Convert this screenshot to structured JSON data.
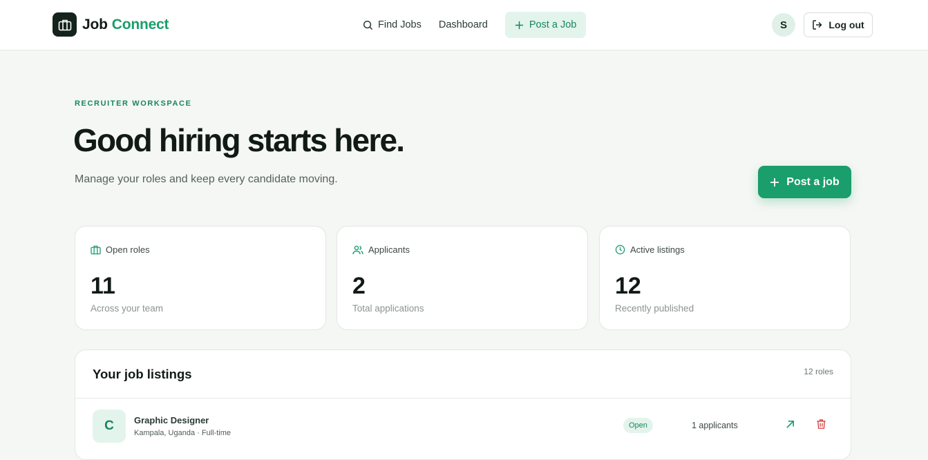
{
  "header": {
    "brand_part1": "Job",
    "brand_part2": "Connect",
    "nav_find_jobs": "Find Jobs",
    "nav_dashboard": "Dashboard",
    "nav_post_job": "Post a Job",
    "avatar_initial": "S",
    "logout_label": "Log out"
  },
  "hero": {
    "eyebrow": "RECRUITER WORKSPACE",
    "title": "Good hiring starts here.",
    "subtitle": "Manage your roles and keep every candidate moving.",
    "cta_label": "Post a job"
  },
  "stats": [
    {
      "icon": "briefcase-icon",
      "label": "Open roles",
      "value": "11",
      "caption": "Across your team"
    },
    {
      "icon": "users-icon",
      "label": "Applicants",
      "value": "2",
      "caption": "Total applications"
    },
    {
      "icon": "clock-icon",
      "label": "Active listings",
      "value": "12",
      "caption": "Recently published"
    }
  ],
  "listings": {
    "title": "Your job listings",
    "count": "12 roles",
    "rows": [
      {
        "initial": "C",
        "title": "Graphic Designer",
        "meta": "Kampala, Uganda · Full-time",
        "status": "Open",
        "applicants": "1 applicants"
      }
    ]
  },
  "colors": {
    "accent": "#1a9e6b",
    "accent_light": "#e3f4ec",
    "dark": "#15231d",
    "danger": "#d23b3b",
    "background": "#f5f7f4"
  }
}
